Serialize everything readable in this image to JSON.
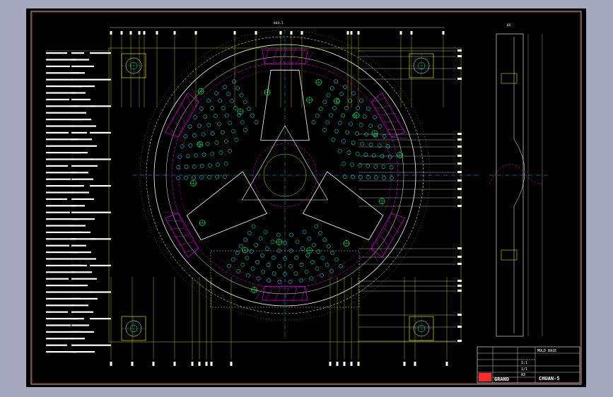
{
  "colors": {
    "background": "#a6a9bd",
    "canvas": "#000000",
    "frame": "#ffffff",
    "border_red": "#ff2a2a",
    "construction": "#ffff00",
    "outline": "#ffffff",
    "holes": "#00ffff",
    "centerline": "#00ffff",
    "purple": "#ff00ff",
    "green": "#00ff66",
    "leader": "#ffff00",
    "hatch": "#ff00ff"
  },
  "drawing": {
    "top_dimension": "843.1",
    "side_dimension": "65"
  },
  "title_block": {
    "company": "GRAND",
    "drawing_number": "CHUAN-5",
    "scale": "1:1",
    "sheet": "1/1",
    "material": "A3",
    "title": "MOLD BASE"
  }
}
